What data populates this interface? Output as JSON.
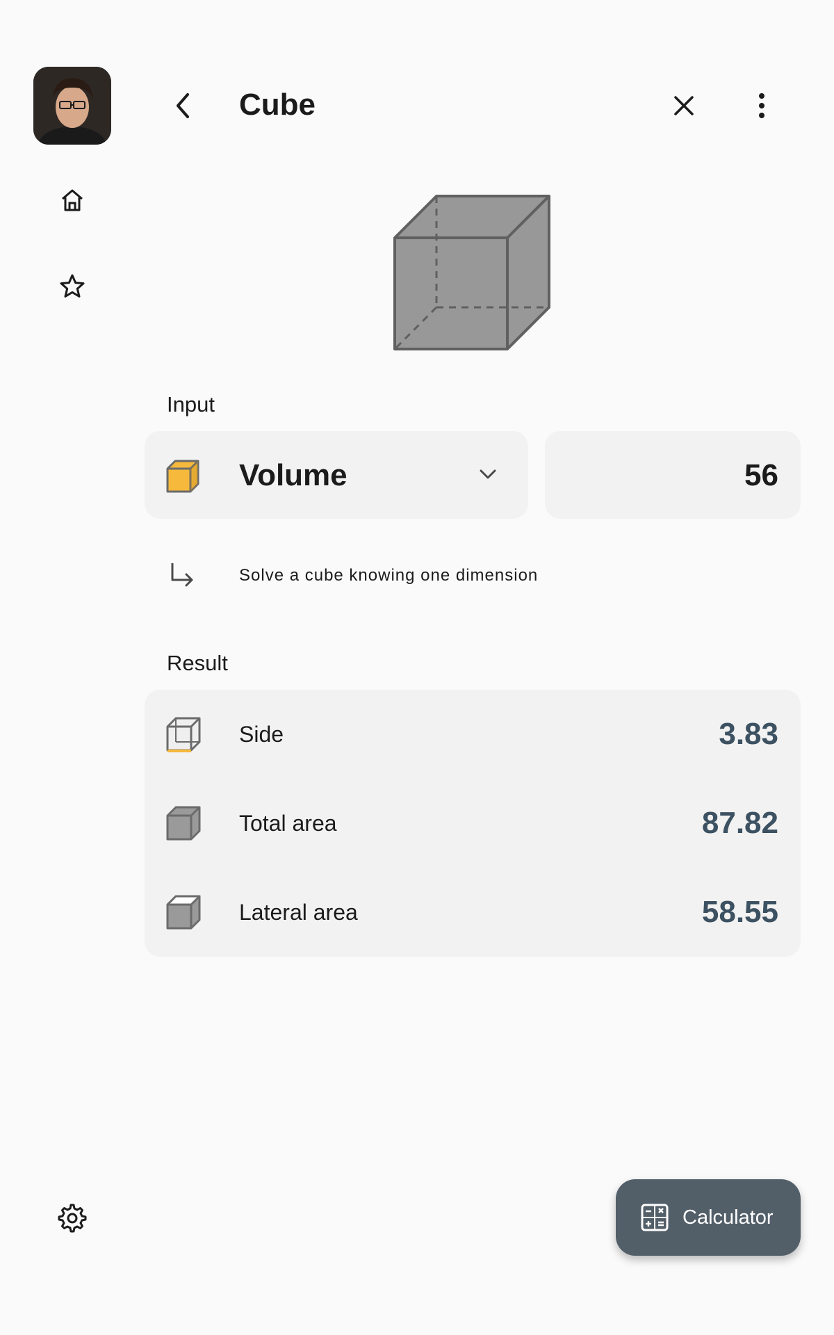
{
  "header": {
    "title": "Cube",
    "back_icon": "arrow-back-icon",
    "close_icon": "close-icon",
    "menu_icon": "more-vert-icon"
  },
  "rail": {
    "avatar": "user-avatar",
    "items": [
      {
        "icon": "home-icon"
      },
      {
        "icon": "star-icon"
      }
    ],
    "settings_icon": "settings-gear-icon"
  },
  "input": {
    "section_label": "Input",
    "selected": "Volume",
    "selected_icon": "cube-volume-icon",
    "value": "56",
    "hint": "Solve a cube knowing one dimension",
    "hint_icon": "subdirectory-arrow-icon"
  },
  "result": {
    "section_label": "Result",
    "rows": [
      {
        "label": "Side",
        "value": "3.83",
        "icon": "cube-side-icon"
      },
      {
        "label": "Total area",
        "value": "87.82",
        "icon": "cube-total-area-icon"
      },
      {
        "label": "Lateral area",
        "value": "58.55",
        "icon": "cube-lateral-area-icon"
      }
    ]
  },
  "fab": {
    "label": "Calculator",
    "icon": "calculator-icon"
  },
  "colors": {
    "background": "#fafafa",
    "card": "#f2f2f2",
    "result_value": "#3c5161",
    "fab": "#525e68",
    "accent_yellow": "#f6b93b",
    "cube_gray": "#999999"
  }
}
